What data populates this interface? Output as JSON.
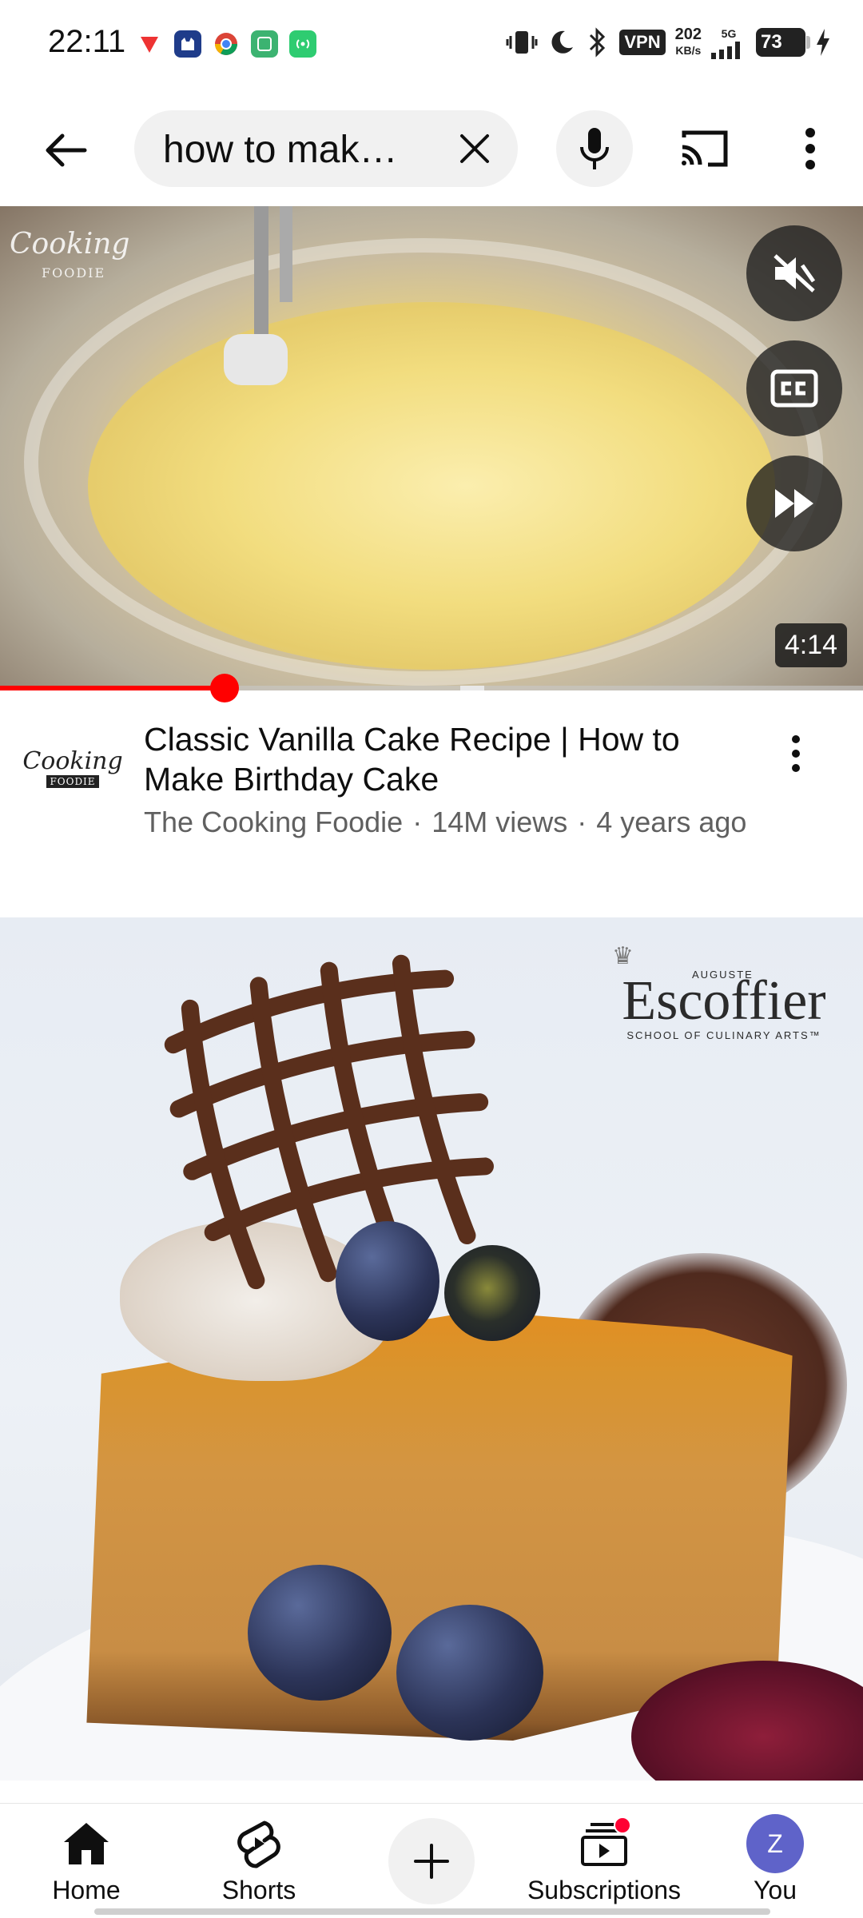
{
  "status_bar": {
    "time": "22:11",
    "vpn": "VPN",
    "speed_value": "202",
    "speed_unit": "KB/s",
    "network": "5G",
    "battery": "73"
  },
  "search": {
    "query": "how to mak…"
  },
  "player": {
    "duration": "4:14",
    "progress_fraction": 0.26,
    "watermark_main": "Cooking",
    "watermark_sub": "FOODIE"
  },
  "video": {
    "title": "Classic Vanilla Cake Recipe | How to Make Birthday Cake",
    "channel": "The Cooking Foodie",
    "views": "14M views",
    "age": "4 years ago",
    "separator": "·",
    "avatar_main": "Cooking",
    "avatar_sub": "FOODIE"
  },
  "thumbnail2": {
    "brand_top": "AUGUSTE",
    "brand_name": "Escoffier",
    "brand_tag": "SCHOOL OF CULINARY ARTS™"
  },
  "bottom_nav": {
    "home": "Home",
    "shorts": "Shorts",
    "subscriptions": "Subscriptions",
    "you": "You",
    "avatar_letter": "Z"
  },
  "colors": {
    "accent_red": "#ff0000",
    "avatar_bg": "#5f63c9"
  }
}
